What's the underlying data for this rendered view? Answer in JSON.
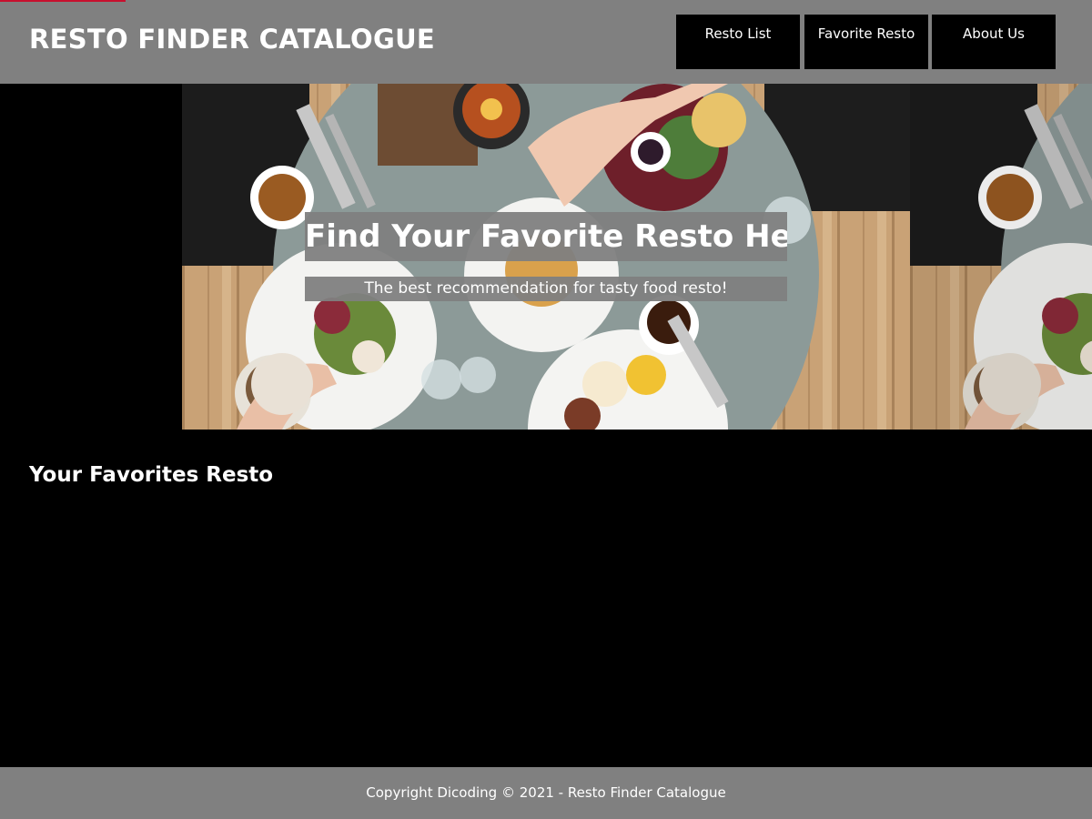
{
  "header": {
    "title": "RESTO FINDER CATALOGUE",
    "nav": [
      {
        "label": "Resto List"
      },
      {
        "label": "Favorite Resto"
      },
      {
        "label": "About Us"
      }
    ]
  },
  "hero": {
    "title": "Find Your Favorite Resto Here!",
    "subtitle": "The best recommendation for tasty food resto!"
  },
  "main": {
    "heading": "Your Favorites Resto"
  },
  "footer": {
    "text": "Copyright Dicoding © 2021 - Resto Finder Catalogue"
  },
  "colors": {
    "header_bg": "#808080",
    "page_bg": "#000000",
    "nav_bg": "#000000",
    "accent_line": "#c8102e"
  }
}
